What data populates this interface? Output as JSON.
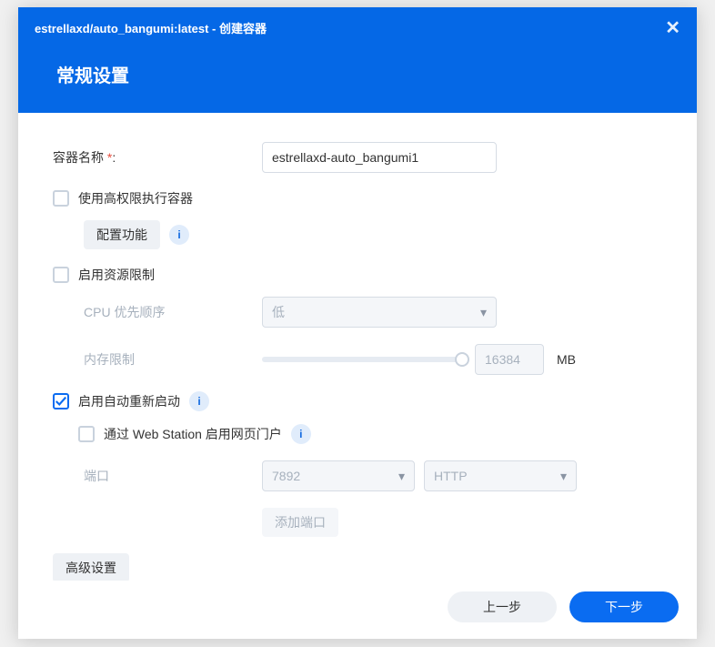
{
  "header": {
    "title": "estrellaxd/auto_bangumi:latest - 创建容器",
    "subtitle": "常规设置"
  },
  "form": {
    "container_name_label": "容器名称 ",
    "container_name_value": "estrellaxd-auto_bangumi1",
    "high_priv_label": "使用高权限执行容器",
    "config_btn": "配置功能",
    "resource_limit_label": "启用资源限制",
    "cpu_priority_label": "CPU 优先顺序",
    "cpu_priority_value": "低",
    "mem_limit_label": "内存限制",
    "mem_limit_value": "16384",
    "mem_unit": "MB",
    "auto_restart_label": "启用自动重新启动",
    "web_station_label": "通过 Web Station 启用网页门户",
    "port_label": "端口",
    "port_value": "7892",
    "port_proto": "HTTP",
    "add_port_btn": "添加端口",
    "adv_btn": "高级设置"
  },
  "footer": {
    "prev": "上一步",
    "next": "下一步"
  }
}
